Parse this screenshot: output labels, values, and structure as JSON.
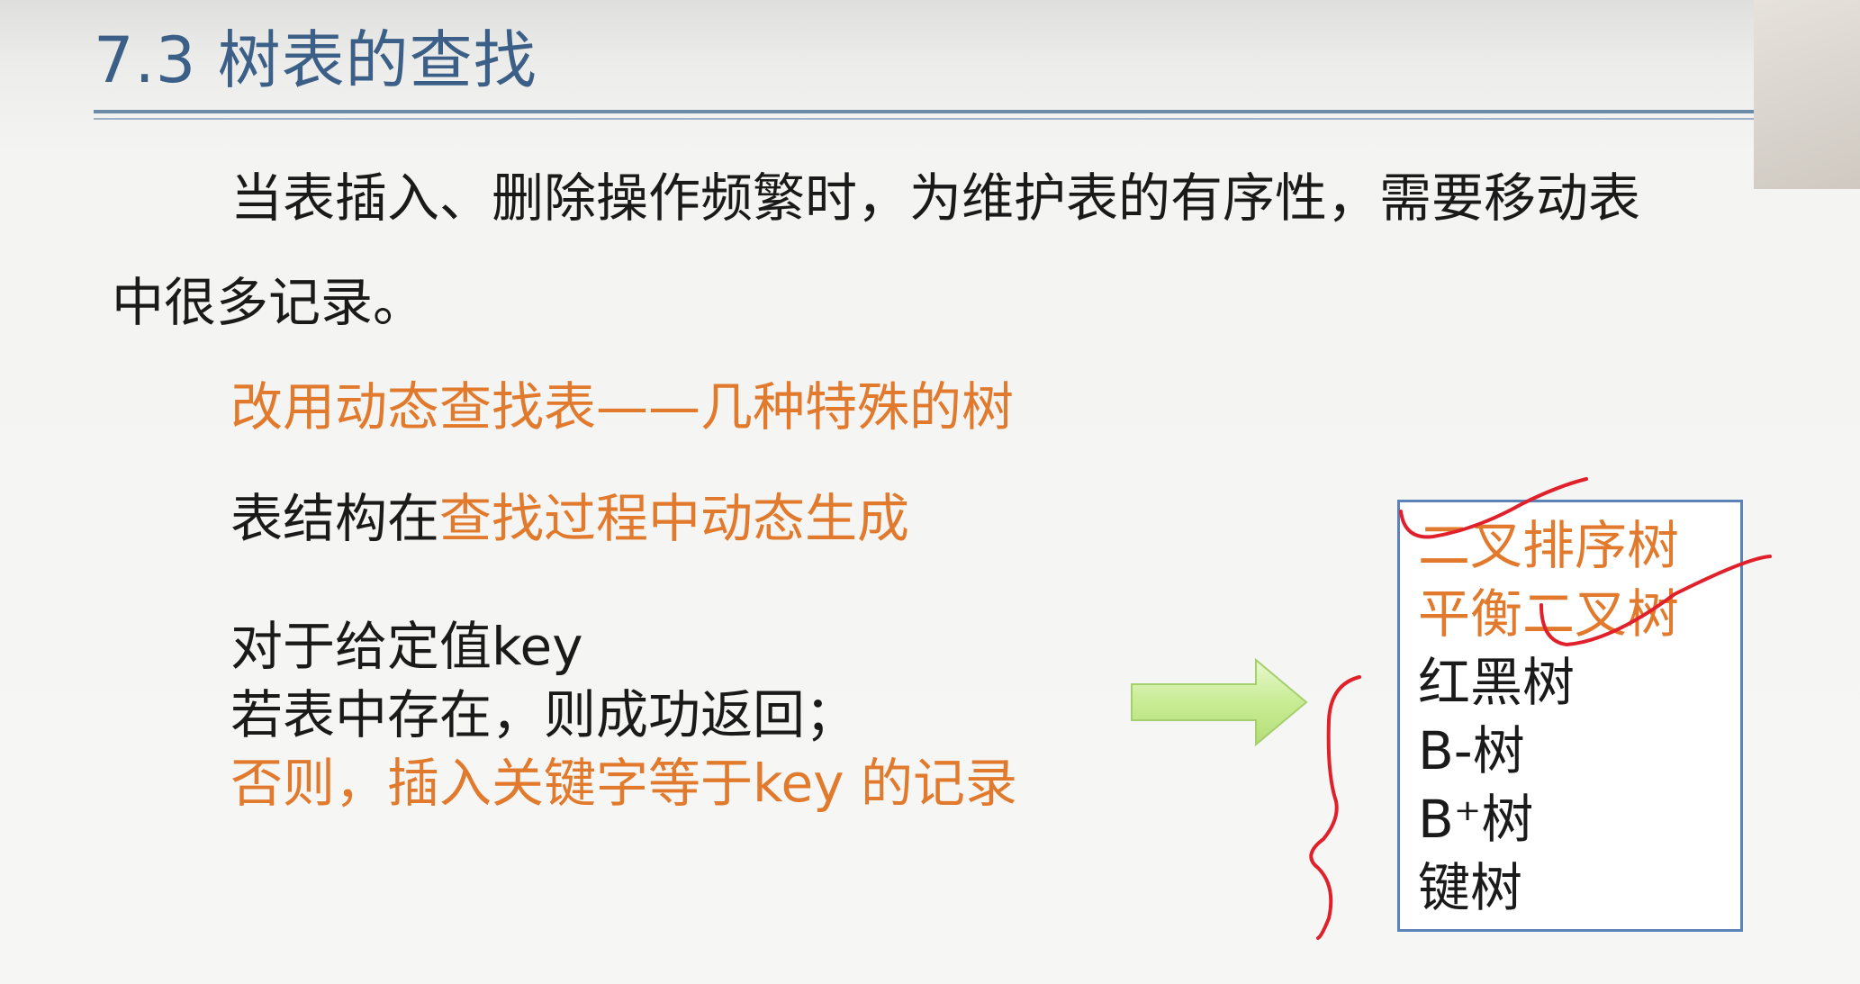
{
  "slide": {
    "title": "7.3 树表的查找",
    "paragraph_line1": "当表插入、删除操作频繁时，为维护表的有序性，需要移动表",
    "paragraph_line2": "中很多记录。",
    "dynamic_table_line": "改用动态查找表——几种特殊的树",
    "structure_prefix": "表结构在",
    "structure_highlight": "查找过程中动态生成",
    "key_line1": "对于给定值key",
    "key_line2": "若表中存在，则成功返回；",
    "key_line3": "否则，插入关键字等于key 的记录"
  },
  "tree_list": {
    "items": [
      {
        "label": "二叉排序树",
        "highlight": true
      },
      {
        "label": "平衡二叉树",
        "highlight": true
      },
      {
        "label": "红黑树",
        "highlight": false
      },
      {
        "label": "B-树",
        "highlight": false
      },
      {
        "label": "B⁺树",
        "highlight": false
      },
      {
        "label": "键树",
        "highlight": false
      }
    ]
  },
  "colors": {
    "title": "#3b5f86",
    "highlight": "#e27a2e",
    "annotation_ink": "#e0202a",
    "box_border": "#5b83b8",
    "arrow_fill": "#c8ec94"
  },
  "icons": {
    "arrow": "right-arrow-icon"
  }
}
